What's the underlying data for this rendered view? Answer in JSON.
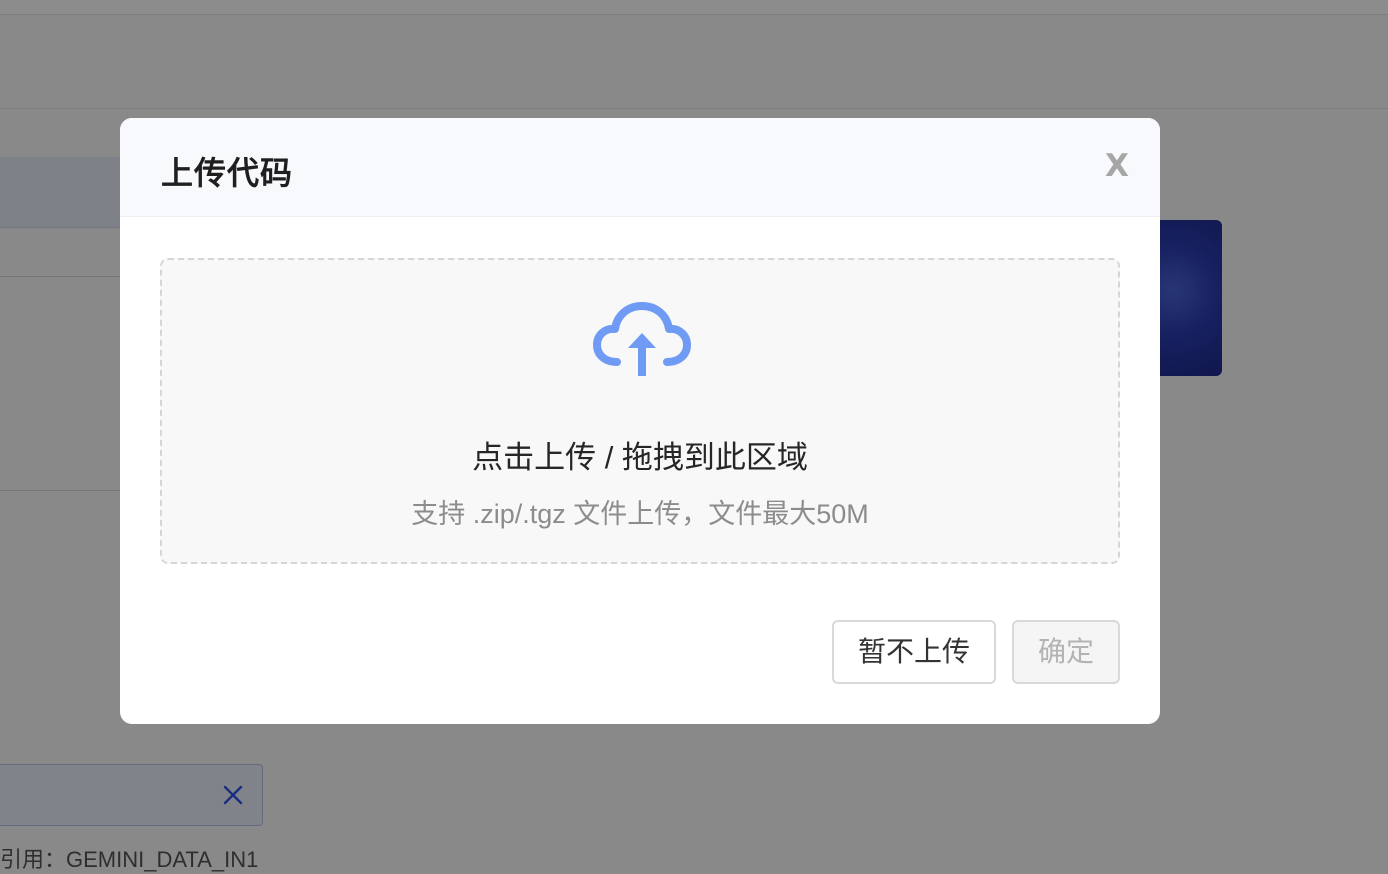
{
  "background": {
    "reference_text": "引用：GEMINI_DATA_IN1",
    "alert_close_icon": "close-icon"
  },
  "modal": {
    "title": "上传代码",
    "close_label": "X",
    "upload": {
      "icon": "cloud-upload-icon",
      "icon_color": "#6f9bf5",
      "title": "点击上传 / 拖拽到此区域",
      "hint": "支持 .zip/.tgz 文件上传，文件最大50M"
    },
    "buttons": {
      "skip_label": "暂不上传",
      "confirm_label": "确定",
      "confirm_disabled": true
    }
  }
}
